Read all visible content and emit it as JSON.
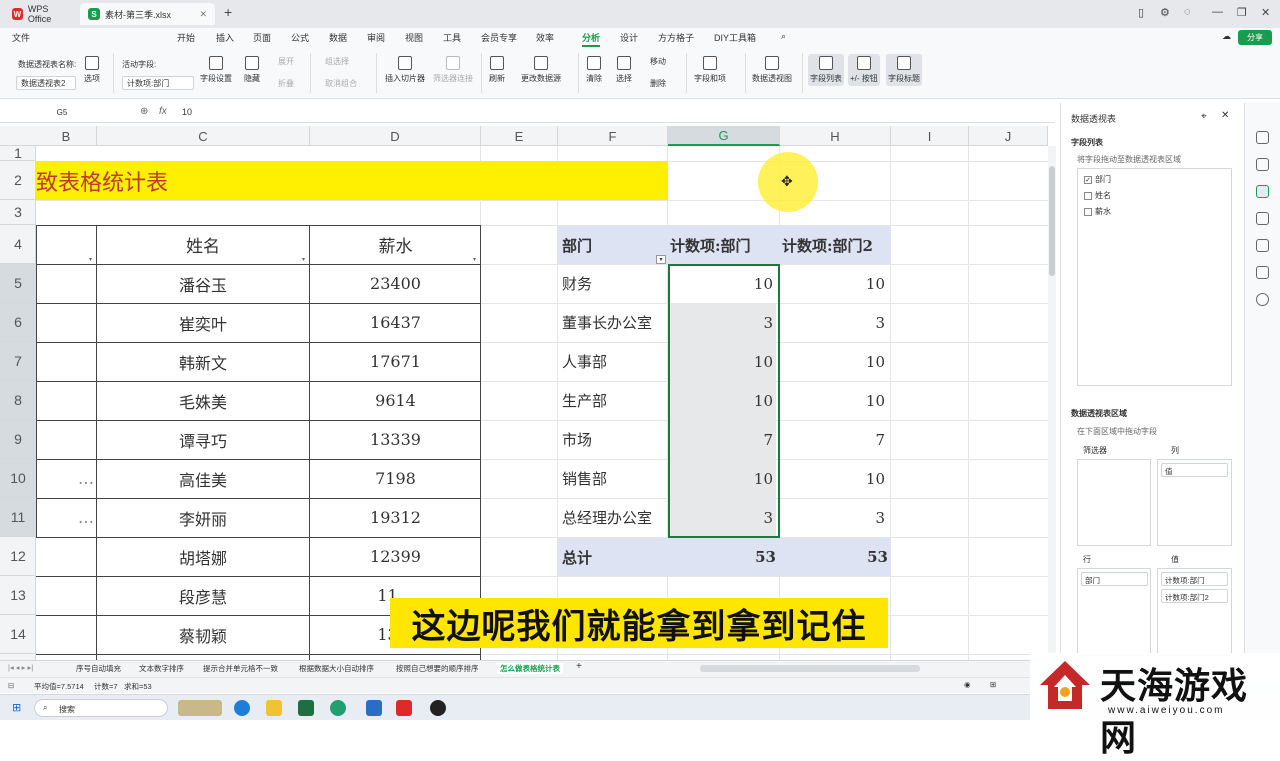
{
  "titlebar": {
    "app_tab": "WPS Office",
    "file_tab": "素材-第三季.xlsx"
  },
  "menu": {
    "items": [
      "开始",
      "插入",
      "页面",
      "公式",
      "数据",
      "审阅",
      "视图",
      "工具",
      "会员专享",
      "效率",
      "分析",
      "设计",
      "方方格子",
      "DIY工具箱"
    ],
    "file": "文件",
    "share": "分享"
  },
  "ribbon": {
    "pivot_name_label": "数据透视表名称:",
    "pivot_name_value": "数据透视表2",
    "options": "选项",
    "active_field_label": "活动字段:",
    "active_field_value": "计数项:部门",
    "field_settings": "字段设置",
    "hide": "隐藏",
    "expand": "展开",
    "collapse": "折叠",
    "group_select": "组选择",
    "cancel_group": "取消组合",
    "insert_slicer": "插入切片器",
    "filter_connection": "筛选器连接",
    "refresh": "刷新",
    "change_source": "更改数据源",
    "clear": "清除",
    "select": "选择",
    "move": "移动",
    "delete": "删除",
    "fields_items": "字段和项",
    "pivot_chart": "数据透视图",
    "field_list": "字段列表",
    "plus_minus": "+/- 按钮",
    "field_header": "字段标题"
  },
  "formula": {
    "cell_ref": "G5",
    "value": "10"
  },
  "columns": [
    "B",
    "C",
    "D",
    "E",
    "F",
    "G",
    "H",
    "I",
    "J"
  ],
  "rows": [
    "1",
    "2",
    "3",
    "4",
    "5",
    "6",
    "7",
    "8",
    "9",
    "10",
    "11",
    "12",
    "13",
    "14"
  ],
  "sheet": {
    "title": "致表格统计表",
    "header_name": "姓名",
    "header_salary": "薪水",
    "names": [
      "潘谷玉",
      "崔奕叶",
      "韩新文",
      "毛姝美",
      "谭寻巧",
      "高佳美",
      "李妍丽",
      "胡塔娜",
      "段彦慧",
      "蔡韧颖"
    ],
    "salaries": [
      "23400",
      "16437",
      "17671",
      "9614",
      "13339",
      "7198",
      "19312",
      "12399",
      "11…",
      "13…"
    ],
    "b_fragments": [
      "",
      "",
      "",
      "",
      "",
      "…",
      "…"
    ]
  },
  "pivot": {
    "header_dept": "部门",
    "header_count1": "计数项:部门",
    "header_count2": "计数项:部门2",
    "rows": [
      {
        "dept": "财务",
        "c1": "10",
        "c2": "10"
      },
      {
        "dept": "董事长办公室",
        "c1": "3",
        "c2": "3"
      },
      {
        "dept": "人事部",
        "c1": "10",
        "c2": "10"
      },
      {
        "dept": "生产部",
        "c1": "10",
        "c2": "10"
      },
      {
        "dept": "市场",
        "c1": "7",
        "c2": "7"
      },
      {
        "dept": "销售部",
        "c1": "10",
        "c2": "10"
      },
      {
        "dept": "总经理办公室",
        "c1": "3",
        "c2": "3"
      }
    ],
    "total_label": "总计",
    "total1": "53",
    "total2": "53"
  },
  "panel": {
    "title": "数据透视表",
    "field_list": "字段列表",
    "drag_hint": "将字段拖动至数据透视表区域",
    "fields": [
      {
        "name": "部门",
        "checked": true
      },
      {
        "name": "姓名",
        "checked": false
      },
      {
        "name": "薪水",
        "checked": false
      }
    ],
    "areas_title": "数据透视表区域",
    "areas_hint": "在下面区域中拖动字段",
    "filter": "筛选器",
    "columns": "列",
    "rows": "行",
    "values": "值",
    "col_item": "值",
    "row_item": "部门",
    "value_items": [
      "计数项:部门",
      "计数项:部门2"
    ]
  },
  "sheet_tabs": [
    "序号自动填充",
    "文本数字排序",
    "提示合并单元格不一致",
    "根据数据大小自动排序",
    "按照自己想要的顺序排序",
    "怎么做表格统计表"
  ],
  "status": {
    "avg": "平均值=7.5714",
    "count": "计数=7",
    "sum": "求和=53"
  },
  "taskbar": {
    "search": "搜索"
  },
  "subtitle": "这边呢我们就能拿到拿到记住",
  "watermark": {
    "name": "天海游戏网",
    "url": "www.aiweiyou.com"
  },
  "colors": {
    "accent": "#1a9c4f",
    "title_fill": "#ffef00",
    "pivot_header": "#dde3f2",
    "subtitle_bg": "#ffe600"
  }
}
